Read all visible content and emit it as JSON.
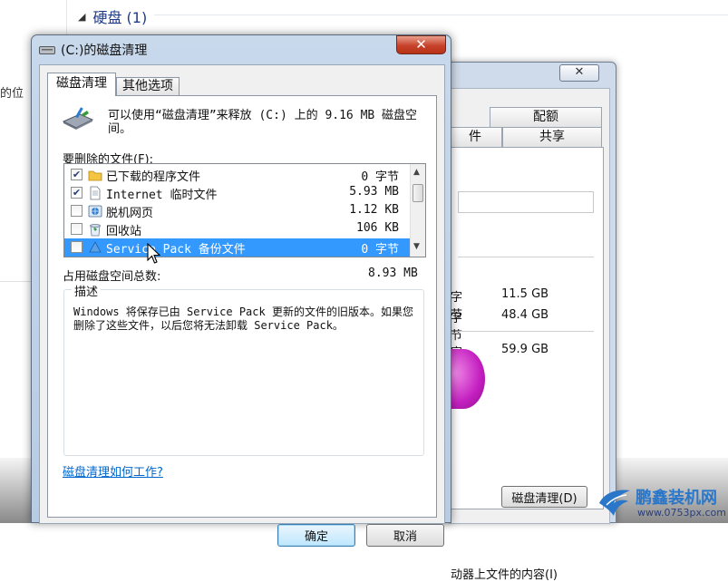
{
  "explorer": {
    "group_header": "硬盘 (1)",
    "left_fragment": "的位"
  },
  "properties": {
    "close_label": "✕",
    "tabs": [
      "配额",
      "件",
      "共享"
    ],
    "usage_rows": [
      {
        "unit": "字节",
        "size": "11.5 GB"
      },
      {
        "unit": "字节",
        "size": "48.4 GB"
      },
      {
        "unit": "字节",
        "size": "59.9 GB"
      }
    ],
    "pie_used_color": "#c41fc0",
    "disk_cleanup_button": "磁盘清理(D)",
    "bottom_text": "动器上文件的内容(I)"
  },
  "dialog": {
    "title": "(C:)的磁盘清理",
    "close_label": "✕",
    "tabs": {
      "cleanup": "磁盘清理",
      "more_options": "其他选项"
    },
    "intro": "可以使用“磁盘清理”来释放 (C:) 上的 9.16 MB 磁盘空间。",
    "files_label": "要删除的文件(F):",
    "files": [
      {
        "name": "已下载的程序文件",
        "size": "0 字节",
        "checked": true,
        "icon": "folder-icon"
      },
      {
        "name": "Internet 临时文件",
        "size": "5.93 MB",
        "checked": true,
        "icon": "document-icon"
      },
      {
        "name": "脱机网页",
        "size": "1.12 KB",
        "checked": false,
        "icon": "offline-pages-icon"
      },
      {
        "name": "回收站",
        "size": "106 KB",
        "checked": false,
        "icon": "recycle-bin-icon"
      },
      {
        "name": "Service Pack 备份文件",
        "size": "0 字节",
        "checked": false,
        "icon": "service-pack-icon",
        "selected": true
      }
    ],
    "total_label": "占用磁盘空间总数:",
    "total_value": "8.93 MB",
    "description_label": "描述",
    "description": "Windows 将保存已由 Service Pack 更新的文件的旧版本。如果您删除了这些文件，以后您将无法卸载 Service Pack。",
    "help_link": "磁盘清理如何工作?",
    "ok_label": "确定",
    "cancel_label": "取消"
  },
  "watermark": {
    "brand": "鹏鑫装机网",
    "url": "www.0753px.com"
  },
  "colors": {
    "selection": "#3399ff",
    "link": "#0066cc",
    "title_bar": "#c9d9ec",
    "close_button": "#c7422a"
  }
}
